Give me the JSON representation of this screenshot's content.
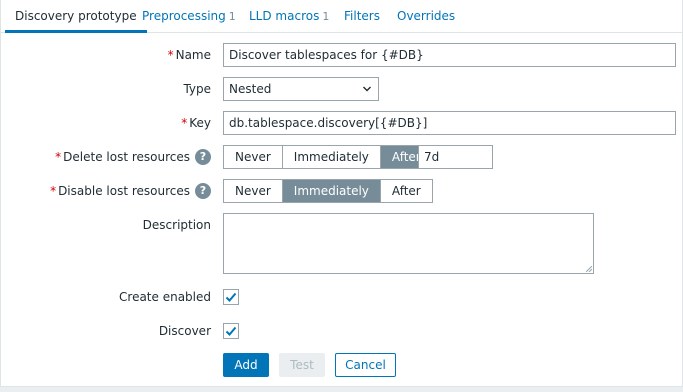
{
  "tabs": [
    {
      "label": "Discovery prototype",
      "count": ""
    },
    {
      "label": "Preprocessing",
      "count": "1"
    },
    {
      "label": "LLD macros",
      "count": "1"
    },
    {
      "label": "Filters",
      "count": ""
    },
    {
      "label": "Overrides",
      "count": ""
    }
  ],
  "form": {
    "name": {
      "label": "Name",
      "required_mark": "*",
      "value": "Discover tablespaces for {#DB}"
    },
    "type": {
      "label": "Type",
      "value": "Nested"
    },
    "key": {
      "label": "Key",
      "required_mark": "*",
      "value": "db.tablespace.discovery[{#DB}]"
    },
    "delete_lost": {
      "label": "Delete lost resources",
      "required_mark": "*",
      "help": "?",
      "options": [
        "Never",
        "Immediately",
        "After"
      ],
      "selected": "After",
      "period": "7d"
    },
    "disable_lost": {
      "label": "Disable lost resources",
      "required_mark": "*",
      "help": "?",
      "options": [
        "Never",
        "Immediately",
        "After"
      ],
      "selected": "Immediately"
    },
    "description": {
      "label": "Description",
      "value": ""
    },
    "create_enabled": {
      "label": "Create enabled",
      "checked": true
    },
    "discover": {
      "label": "Discover",
      "checked": true
    }
  },
  "buttons": {
    "add": "Add",
    "test": "Test",
    "cancel": "Cancel"
  },
  "colors": {
    "accent": "#0275b8",
    "selected_segment": "#768d99",
    "required": "#d40000"
  }
}
